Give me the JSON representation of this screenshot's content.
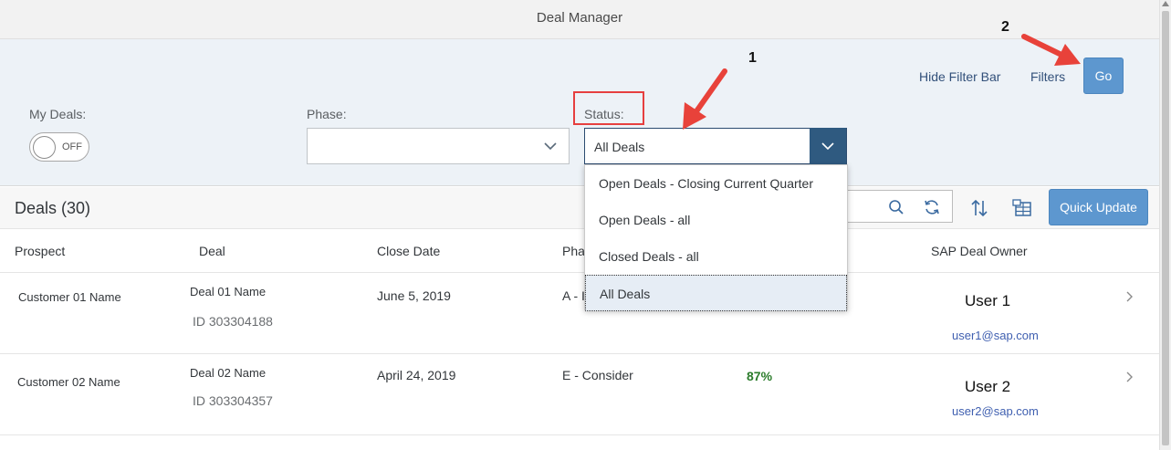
{
  "header": {
    "title": "Deal Manager"
  },
  "filterbar": {
    "hide_filter_bar": "Hide Filter Bar",
    "filters": "Filters",
    "go": "Go",
    "my_deals": {
      "label": "My Deals:",
      "toggle_text": "OFF",
      "on": false
    },
    "phase": {
      "label": "Phase:",
      "value": ""
    },
    "status": {
      "label": "Status:",
      "value": "All Deals"
    }
  },
  "annotations": {
    "step1": "1",
    "step2": "2",
    "arrow_color": "#e8423a"
  },
  "status_dropdown": {
    "options": [
      "Open Deals - Closing Current Quarter",
      "Open Deals - all",
      "Closed Deals - all",
      "All Deals"
    ],
    "selected_index": 3
  },
  "toolbar": {
    "title": "Deals (30)",
    "quick_update": "Quick Update"
  },
  "table": {
    "columns": {
      "prospect": "Prospect",
      "deal": "Deal",
      "close_date": "Close Date",
      "phase": "Pha",
      "owner": "SAP Deal Owner"
    },
    "rows": [
      {
        "prospect": "Customer 01 Name",
        "deal_name": "Deal 01 Name",
        "deal_id": "ID 303304188",
        "close_date": "June 5, 2019",
        "phase": "A - I",
        "probability": "",
        "owner": "User 1",
        "email": "user1@sap.com"
      },
      {
        "prospect": "Customer 02 Name",
        "deal_name": "Deal 02 Name",
        "deal_id": "ID 303304357",
        "close_date": "April 24, 2019",
        "phase": "E - Consider",
        "probability": "87%",
        "owner": "User 2",
        "email": "user2@sap.com"
      }
    ]
  },
  "colors": {
    "accent": "#5d97cf",
    "dark_accent": "#2f5a80",
    "link": "#32507a",
    "success": "#2b7c2b"
  }
}
